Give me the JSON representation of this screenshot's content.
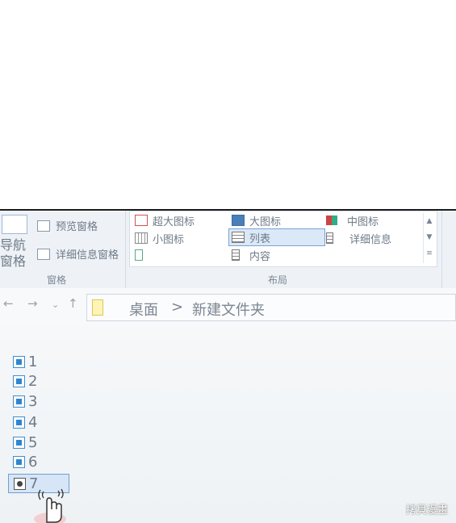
{
  "ribbon": {
    "pane_group": {
      "nav_pane_label": "导航\n窗格",
      "preview_pane": "预览窗格",
      "details_pane": "详细信息窗格",
      "group_label": "窗格"
    },
    "layout_group": {
      "items": {
        "extra_large": "超大图标",
        "large": "大图标",
        "medium": "中图标",
        "small": "小图标",
        "list": "列表",
        "details": "详细信息",
        "tiles": "",
        "content": "内容"
      },
      "group_label": "布局"
    }
  },
  "address_bar": {
    "crumbs": [
      "桌面",
      ">",
      "新建文件夹"
    ]
  },
  "files": [
    "1",
    "2",
    "3",
    "4",
    "5",
    "6",
    "7"
  ],
  "selected_file": "7",
  "watermark": "拷貝漫畫",
  "colors": {
    "accent": "#2f86cf",
    "selection": "#d7e6f6"
  }
}
